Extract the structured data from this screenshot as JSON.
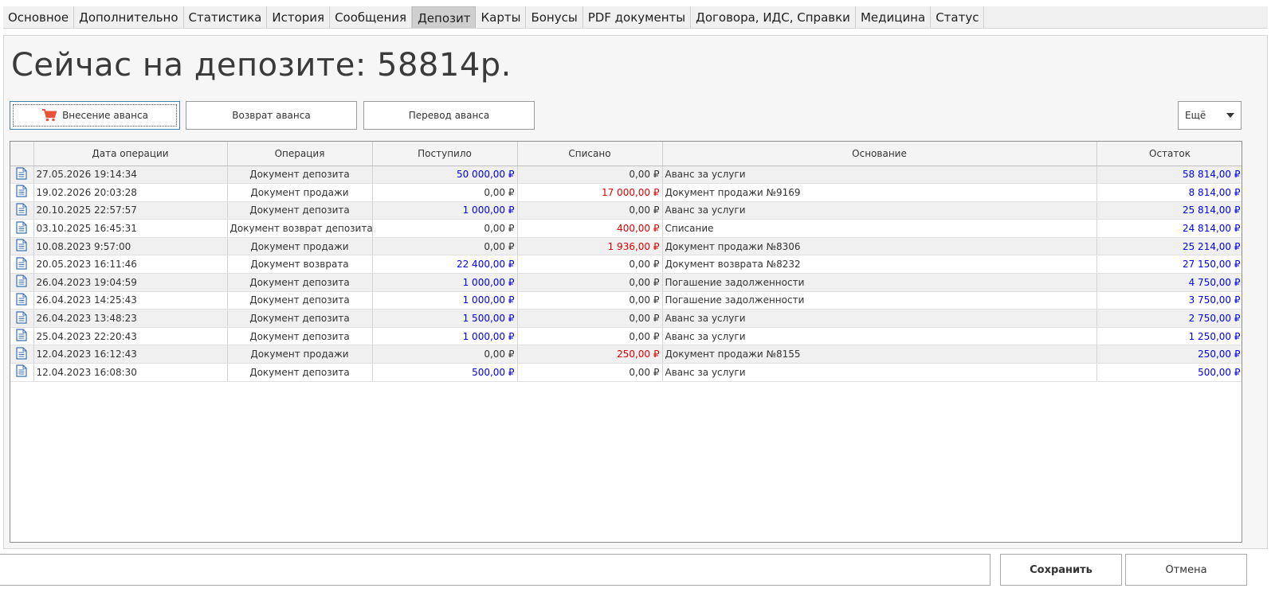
{
  "tabs": [
    {
      "label": "Основное",
      "active": false
    },
    {
      "label": "Дополнительно",
      "active": false
    },
    {
      "label": "Статистика",
      "active": false
    },
    {
      "label": "История",
      "active": false
    },
    {
      "label": "Сообщения",
      "active": false
    },
    {
      "label": "Депозит",
      "active": true
    },
    {
      "label": "Карты",
      "active": false
    },
    {
      "label": "Бонусы",
      "active": false
    },
    {
      "label": "PDF документы",
      "active": false
    },
    {
      "label": "Договора, ИДС, Справки",
      "active": false
    },
    {
      "label": "Медицина",
      "active": false
    },
    {
      "label": "Статус",
      "active": false
    }
  ],
  "title": "Сейчас на депозите: 58814р.",
  "actions": {
    "deposit": "Внесение аванса",
    "refund": "Возврат аванса",
    "transfer": "Перевод аванса",
    "more": "Ещё"
  },
  "table": {
    "columns": [
      "Дата операции",
      "Операция",
      "Поступило",
      "Списано",
      "Основание",
      "Остаток"
    ],
    "rows": [
      {
        "date": "27.05.2026 19:14:34",
        "op": "Документ депозита",
        "in": "50 000,00 ₽",
        "out": "0,00 ₽",
        "basis": "Аванс за услуги",
        "rest": "58 814,00 ₽"
      },
      {
        "date": "19.02.2026 20:03:28",
        "op": "Документ продажи",
        "in": "0,00 ₽",
        "out": "17 000,00 ₽",
        "basis": "Документ продажи №9169",
        "rest": "8 814,00 ₽"
      },
      {
        "date": "20.10.2025 22:57:57",
        "op": "Документ депозита",
        "in": "1 000,00 ₽",
        "out": "0,00 ₽",
        "basis": "Аванс за услуги",
        "rest": "25 814,00 ₽"
      },
      {
        "date": "03.10.2025 16:45:31",
        "op": "Документ возврат депозита",
        "in": "0,00 ₽",
        "out": "400,00 ₽",
        "basis": "Списание",
        "rest": "24 814,00 ₽"
      },
      {
        "date": "10.08.2023 9:57:00",
        "op": "Документ продажи",
        "in": "0,00 ₽",
        "out": "1 936,00 ₽",
        "basis": "Документ продажи №8306",
        "rest": "25 214,00 ₽"
      },
      {
        "date": "20.05.2023 16:11:46",
        "op": "Документ возврата",
        "in": "22 400,00 ₽",
        "out": "0,00 ₽",
        "basis": "Документ возврата №8232",
        "rest": "27 150,00 ₽"
      },
      {
        "date": "26.04.2023 19:04:59",
        "op": "Документ депозита",
        "in": "1 000,00 ₽",
        "out": "0,00 ₽",
        "basis": "Погашение задолженности",
        "rest": "4 750,00 ₽"
      },
      {
        "date": "26.04.2023 14:25:43",
        "op": "Документ депозита",
        "in": "1 000,00 ₽",
        "out": "0,00 ₽",
        "basis": "Погашение задолженности",
        "rest": "3 750,00 ₽"
      },
      {
        "date": "26.04.2023 13:48:23",
        "op": "Документ депозита",
        "in": "1 500,00 ₽",
        "out": "0,00 ₽",
        "basis": "Аванс за услуги",
        "rest": "2 750,00 ₽"
      },
      {
        "date": "25.04.2023 22:20:43",
        "op": "Документ депозита",
        "in": "1 000,00 ₽",
        "out": "0,00 ₽",
        "basis": "Аванс за услуги",
        "rest": "1 250,00 ₽"
      },
      {
        "date": "12.04.2023 16:12:43",
        "op": "Документ продажи",
        "in": "0,00 ₽",
        "out": "250,00 ₽",
        "basis": "Документ продажи №8155",
        "rest": "250,00 ₽"
      },
      {
        "date": "12.04.2023 16:08:30",
        "op": "Документ депозита",
        "in": "500,00 ₽",
        "out": "0,00 ₽",
        "basis": "Аванс за услуги",
        "rest": "500,00 ₽"
      }
    ]
  },
  "footer": {
    "save": "Сохранить",
    "cancel": "Отмена"
  },
  "colors": {
    "income": "#0000e6",
    "expense": "#e00000",
    "cart": "#e8533a",
    "doc_icon": "#3b6fb0"
  },
  "icons": {
    "cart": "shopping-cart-icon",
    "doc": "document-icon",
    "more": "chevron-down-icon"
  }
}
